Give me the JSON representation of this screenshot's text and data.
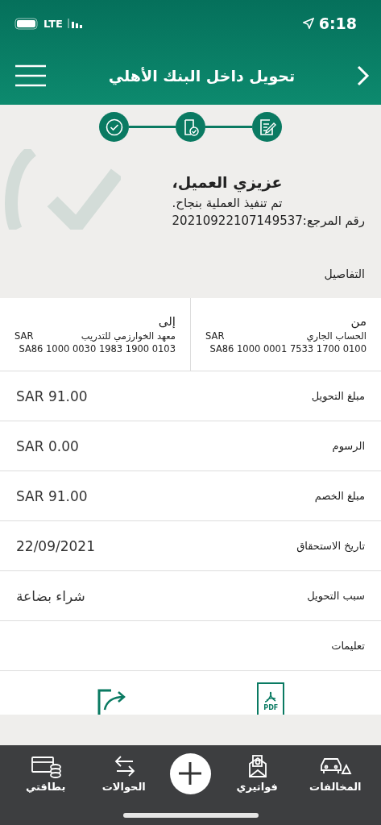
{
  "status_bar": {
    "time": "6:18",
    "network": "LTE"
  },
  "header": {
    "title": "تحويل داخل البنك الأهلي"
  },
  "success": {
    "greeting": "عزيزي العميل،",
    "message": "تم تنفيذ العملية بنجاح.",
    "reference": "رقم المرجع:20210922107149537"
  },
  "details_heading": "التفاصيل",
  "accounts": [
    {
      "title": "من",
      "name": "الحساب الجاري",
      "currency": "SAR",
      "iban": "SA86 1000 0001 7533 1700 0100"
    },
    {
      "title": "إلى",
      "name": "معهد الخوارزمي للتدريب",
      "currency": "SAR",
      "iban": "SA86 1000 0030 1983 1900 0103"
    }
  ],
  "details": [
    {
      "label": "مبلغ التحويل",
      "value": "SAR 91.00"
    },
    {
      "label": "الرسوم",
      "value": "SAR 0.00"
    },
    {
      "label": "مبلغ الخصم",
      "value": "SAR 91.00"
    },
    {
      "label": "تاريخ الاستحقاق",
      "value": "22/09/2021"
    },
    {
      "label": "سبب التحويل",
      "value": "شراء بضاعة"
    },
    {
      "label": "تعليمات"
    }
  ],
  "actions": {
    "pdf_label": "PDF"
  },
  "bottom_nav": [
    {
      "label": "المخالفات",
      "kind": "fines"
    },
    {
      "label": "فواتيري",
      "kind": "bills"
    },
    {
      "kind": "add"
    },
    {
      "label": "الحوالات",
      "kind": "transfers"
    },
    {
      "label": "بطاقتي",
      "kind": "cards"
    }
  ]
}
